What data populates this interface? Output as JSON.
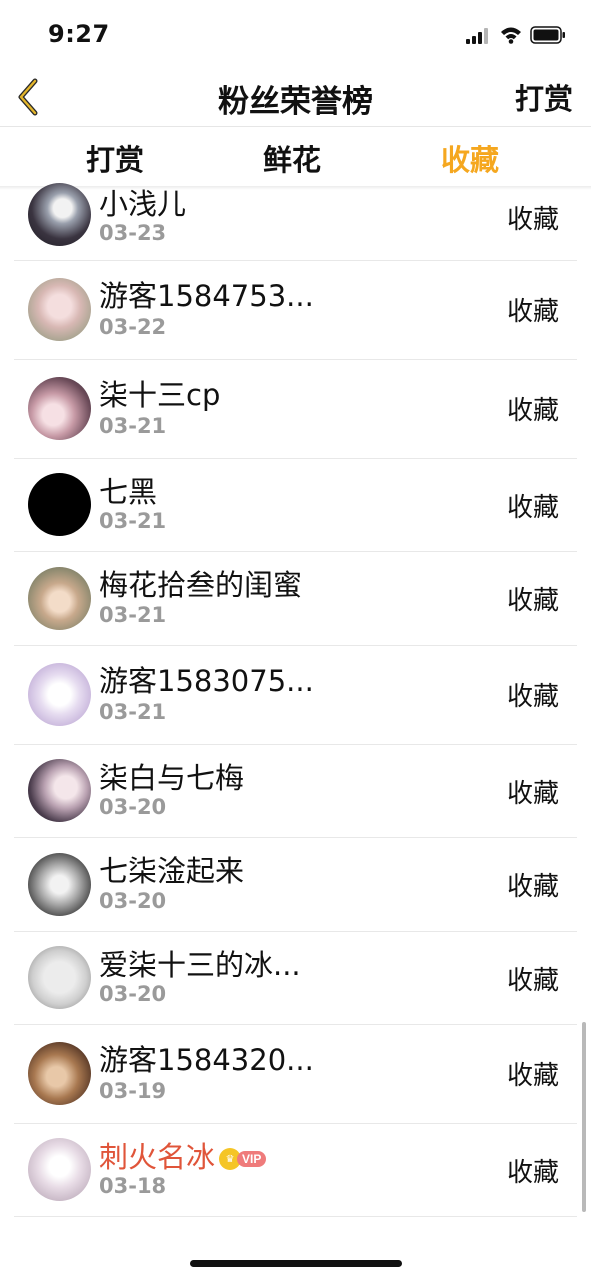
{
  "status": {
    "time": "9:27"
  },
  "nav": {
    "title": "粉丝荣誉榜",
    "action": "打赏"
  },
  "tabs": [
    {
      "label": "打赏",
      "active": false
    },
    {
      "label": "鲜花",
      "active": false
    },
    {
      "label": "收藏",
      "active": true
    }
  ],
  "colors": {
    "accent": "#f5a71f",
    "vip_name": "#e0553a",
    "date": "#9a9a9a"
  },
  "rows": [
    {
      "name": "小浅儿",
      "date": "03-23",
      "action": "收藏",
      "avatar": "anime-girl-white-hair"
    },
    {
      "name": "游客1584753...",
      "date": "03-22",
      "action": "收藏",
      "avatar": "photo-girl"
    },
    {
      "name": "柒十三cp",
      "date": "03-21",
      "action": "收藏",
      "avatar": "anime-couple"
    },
    {
      "name": "七黑",
      "date": "03-21",
      "action": "收藏",
      "avatar": "black-circle"
    },
    {
      "name": "梅花拾叁的闺蜜",
      "date": "03-21",
      "action": "收藏",
      "avatar": "photo-girl-cap"
    },
    {
      "name": "游客1583075...",
      "date": "03-21",
      "action": "收藏",
      "avatar": "anime-bunny-girl"
    },
    {
      "name": "柒白与七梅",
      "date": "03-20",
      "action": "收藏",
      "avatar": "anime-pair"
    },
    {
      "name": "七柒淦起来",
      "date": "03-20",
      "action": "收藏",
      "avatar": "manga-bw"
    },
    {
      "name": "爱柒十三的冰...",
      "date": "03-20",
      "action": "收藏",
      "avatar": "meme-face"
    },
    {
      "name": "游客1584320...",
      "date": "03-19",
      "action": "收藏",
      "avatar": "photo-group"
    },
    {
      "name": "刺火名冰",
      "date": "03-18",
      "action": "收藏",
      "avatar": "anime-sketch",
      "vip": true,
      "vip_label": "VIP"
    }
  ]
}
